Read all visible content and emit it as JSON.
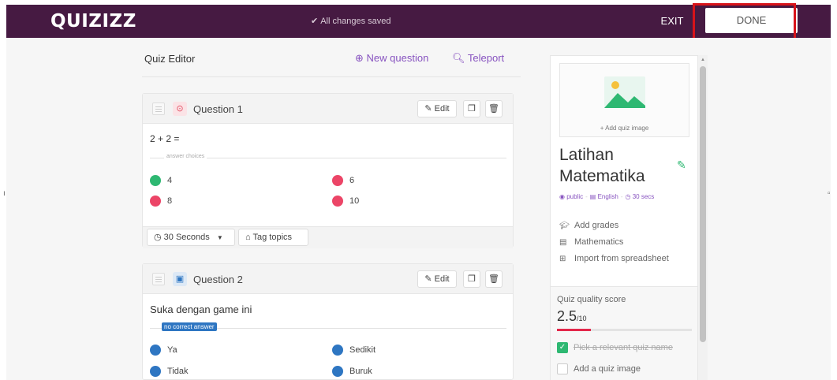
{
  "header": {
    "logo": "QUIZIZZ",
    "save_status": "All changes saved",
    "exit_label": "EXIT",
    "done_label": "DONE"
  },
  "editor": {
    "title": "Quiz Editor",
    "new_question": "New question",
    "teleport": "Teleport"
  },
  "questions": [
    {
      "label": "Question 1",
      "type_icon": "target-icon",
      "text": "2 + 2 =",
      "divider_label": "answer choices",
      "choices": [
        {
          "text": "4",
          "color": "#2eb872"
        },
        {
          "text": "6",
          "color": "#ec4567"
        },
        {
          "text": "8",
          "color": "#ec4567"
        },
        {
          "text": "10",
          "color": "#ec4567"
        }
      ],
      "time_label": "30 Seconds",
      "tag_label": "Tag topics"
    },
    {
      "label": "Question 2",
      "type_icon": "poll-icon",
      "text": "Suka dengan game ini",
      "badge": "no correct answer",
      "choices": [
        {
          "text": "Ya",
          "color": "#2e76c2"
        },
        {
          "text": "Sedikit",
          "color": "#2e76c2"
        },
        {
          "text": "Tidak",
          "color": "#2e76c2"
        },
        {
          "text": "Buruk",
          "color": "#2e76c2"
        }
      ]
    }
  ],
  "buttons": {
    "edit": "Edit"
  },
  "sidebar": {
    "add_image": "+ Add quiz image",
    "quiz_title": "Latihan Matematika",
    "visibility": "public",
    "language": "English",
    "time": "30 secs",
    "links": {
      "grades": "Add grades",
      "subject": "Mathematics",
      "import": "Import from spreadsheet"
    },
    "quality": {
      "label": "Quiz quality score",
      "score": "2.5",
      "out_of": "/10",
      "score_fraction": 0.25,
      "items": [
        {
          "label": "Pick a relevant quiz name",
          "checked": true
        },
        {
          "label": "Add a quiz image",
          "checked": false
        }
      ]
    }
  }
}
